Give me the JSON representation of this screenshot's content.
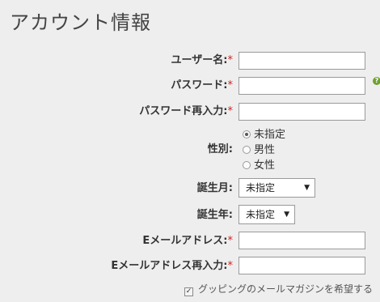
{
  "page": {
    "title": "アカウント情報"
  },
  "form": {
    "required_mark": "*",
    "username": {
      "label": "ユーザー名:",
      "value": ""
    },
    "password": {
      "label": "パスワード:",
      "value": "",
      "help_icon": "question-icon",
      "help_glyph": "?"
    },
    "password_confirm": {
      "label": "パスワード再入力:",
      "value": ""
    },
    "gender": {
      "label": "性別:",
      "options": [
        "未指定",
        "男性",
        "女性"
      ],
      "selected": "未指定"
    },
    "birth_month": {
      "label": "誕生月:",
      "value": "未指定"
    },
    "birth_year": {
      "label": "誕生年:",
      "value": "未指定"
    },
    "email": {
      "label": "Eメールアドレス:",
      "value": ""
    },
    "email_confirm": {
      "label": "Eメールアドレス再入力:",
      "value": ""
    },
    "newsletter": {
      "label": "グッピングのメールマガジンを希望する",
      "checked": true,
      "check_glyph": "✓"
    },
    "select_arrow_glyph": "▼"
  },
  "colors": {
    "background": "#eeeeee",
    "required": "#cc2222",
    "help": "#6fa12e"
  }
}
